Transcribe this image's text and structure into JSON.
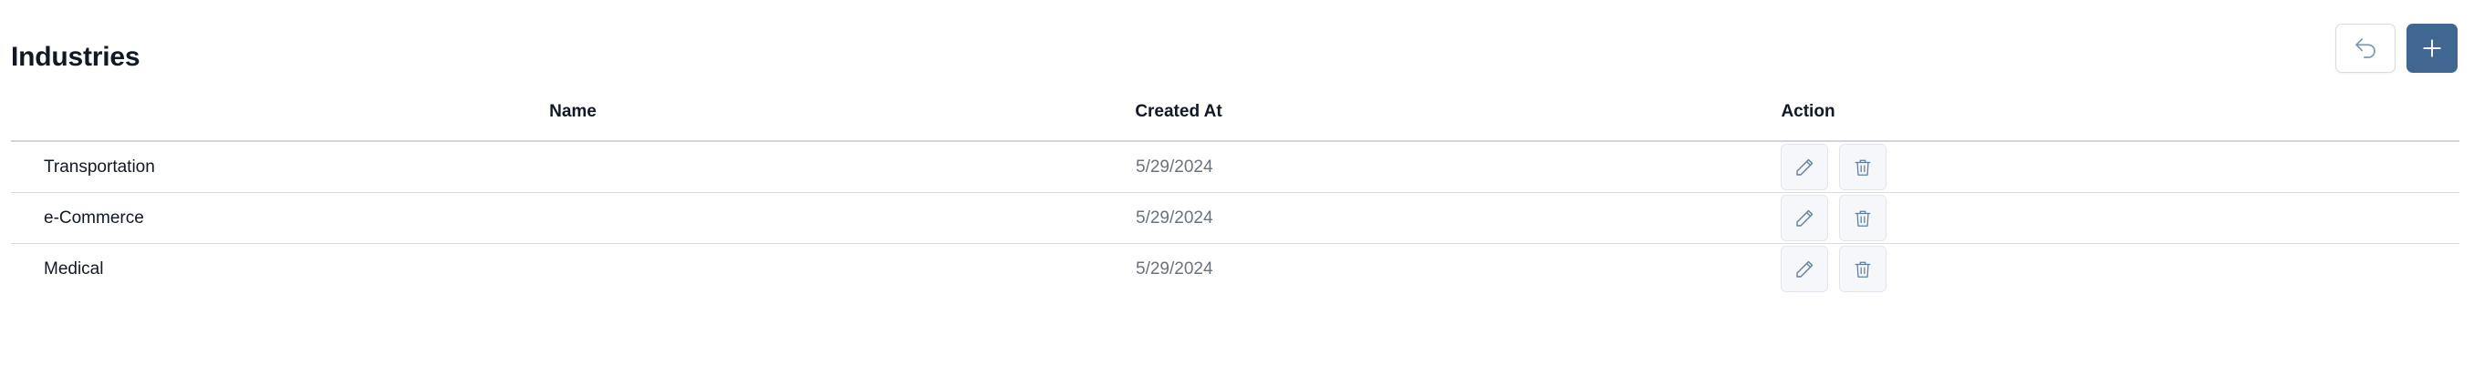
{
  "page": {
    "title": "Industries"
  },
  "toolbar": {
    "back_icon": "undo-arrow-icon",
    "add_icon": "plus-icon",
    "add_color": "#3f6792"
  },
  "table": {
    "columns": [
      "Name",
      "Created At",
      "Action"
    ],
    "rows": [
      {
        "name": "Transportation",
        "created_at": "5/29/2024"
      },
      {
        "name": "e-Commerce",
        "created_at": "5/29/2024"
      },
      {
        "name": "Medical",
        "created_at": "5/29/2024"
      }
    ],
    "row_actions": [
      "pencil-icon",
      "trash-icon"
    ]
  }
}
